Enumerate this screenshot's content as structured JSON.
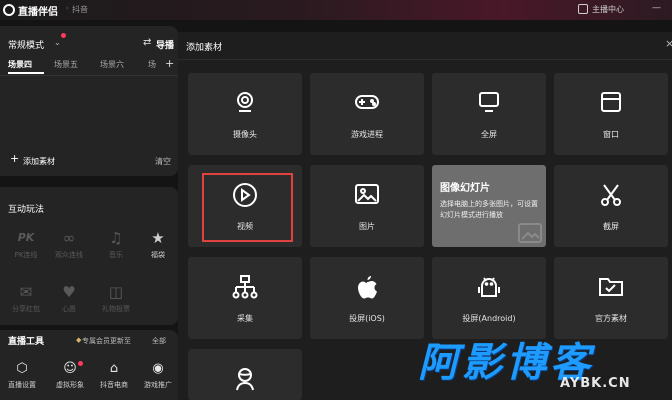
{
  "topbar": {
    "title": "直播伴侣",
    "separator": "·",
    "platform": "抖音",
    "host_center": "主播中心",
    "window_controls": "—"
  },
  "left": {
    "mode_label": "常规模式",
    "guide_label": "导播",
    "scene_tabs": [
      "场景四",
      "场景五",
      "场景六",
      "场"
    ],
    "add_source_label": "添加素材",
    "clear_label": "清空",
    "interact_title": "互动玩法",
    "interact_items": [
      {
        "label": "PK连线",
        "icon": "PK"
      },
      {
        "label": "观众连线",
        "icon": "∞"
      },
      {
        "label": "音乐",
        "icon": "♫"
      },
      {
        "label": "福袋",
        "icon": "★"
      },
      {
        "label": "分享红包",
        "icon": "✉"
      },
      {
        "label": "心愿",
        "icon": "♥"
      },
      {
        "label": "礼物投票",
        "icon": "◫"
      }
    ],
    "tools_title": "直播工具",
    "tools_vip": "专属会员更新至",
    "tools_all": "全部",
    "tool_items": [
      {
        "label": "直播设置",
        "icon": "⬡"
      },
      {
        "label": "虚拟形象",
        "icon": "☺"
      },
      {
        "label": "抖音电商",
        "icon": "⌂"
      },
      {
        "label": "游戏推广",
        "icon": "◉"
      }
    ]
  },
  "modal": {
    "title": "添加素材",
    "close": "×",
    "tiles": [
      {
        "label": "摄像头",
        "icon": "camera-icon"
      },
      {
        "label": "游戏进程",
        "icon": "gamepad-icon"
      },
      {
        "label": "全屏",
        "icon": "monitor-icon"
      },
      {
        "label": "窗口",
        "icon": "window-icon"
      },
      {
        "label": "视频",
        "icon": "play-icon"
      },
      {
        "label": "图片",
        "icon": "image-icon"
      },
      {
        "label": "图像幻灯片",
        "icon": "slideshow-icon"
      },
      {
        "label": "截屏",
        "icon": "scissors-icon"
      },
      {
        "label": "采集",
        "icon": "hierarchy-icon"
      },
      {
        "label": "投屏(iOS)",
        "icon": "apple-icon"
      },
      {
        "label": "投屏(Android)",
        "icon": "android-icon"
      },
      {
        "label": "官方素材",
        "icon": "folder-check-icon"
      },
      {
        "label": "",
        "icon": "avatar-icon"
      }
    ],
    "hover_tile": {
      "title": "图像幻灯片",
      "description": "选择电脑上的多张图片，可设置幻灯片模式进行播放"
    }
  },
  "watermark": {
    "main": "阿影博客",
    "sub": "AYBK.CN"
  },
  "colors": {
    "background": "#141414",
    "panel": "#242424",
    "tile": "#2c2c2c",
    "tile_hover": "#6e6e6e",
    "highlight": "#e0433f",
    "accent_dot": "#ff3b5c",
    "watermark": "#1e9bff"
  }
}
